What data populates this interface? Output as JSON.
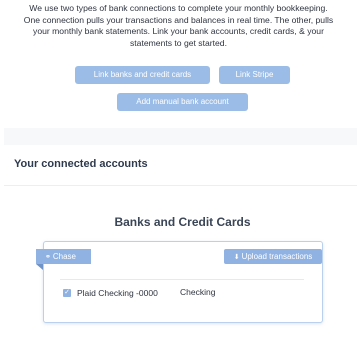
{
  "intro": {
    "text": "We use two types of bank connections to complete your monthly bookkeeping. One connection pulls your transactions and balances in real time. The other, pulls your monthly bank statements. Link your bank accounts, credit cards, & your statements to get started."
  },
  "buttons": {
    "link_banks": "Link banks and credit cards",
    "link_stripe": "Link Stripe",
    "add_manual": "Add manual bank account"
  },
  "connected": {
    "title": "Your connected accounts"
  },
  "banks_card": {
    "heading": "Banks and Credit Cards",
    "institution": {
      "name": "Chase",
      "icon": "link-icon"
    },
    "upload_button": {
      "label": "Upload transactions",
      "icon": "upload-icon"
    },
    "accounts": [
      {
        "name": "Plaid Checking -0000",
        "type": "Checking",
        "checked": true
      }
    ]
  },
  "colors": {
    "button_light": "#9bbce6",
    "tag_blue": "#8fb2e2",
    "card_border": "#b9d0ee",
    "text_dark": "#2f3440"
  }
}
